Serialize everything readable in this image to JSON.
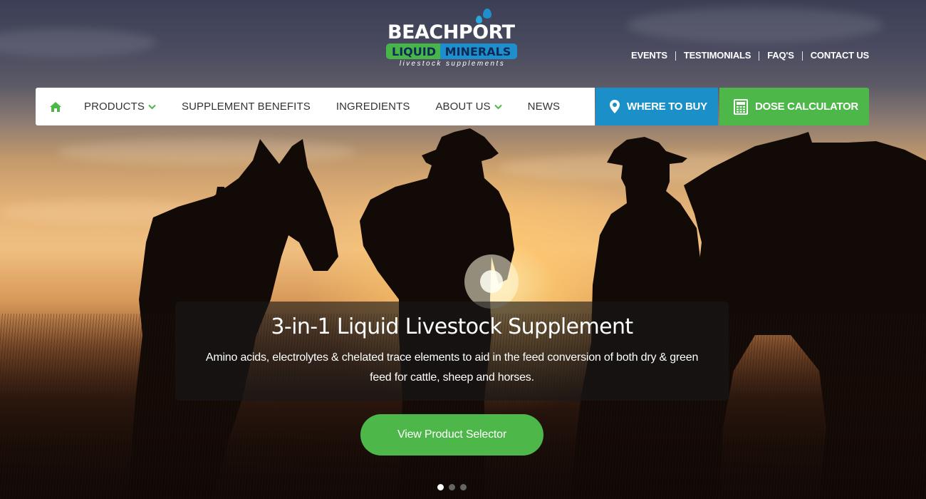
{
  "brand": {
    "name_line1": "BEACHPORT",
    "name_line2a": "LIQUID",
    "name_line2b": "MINERALS",
    "tagline": "livestock supplements",
    "colors": {
      "green": "#4db849",
      "blue": "#1a8fc8",
      "navy": "#0d2a55"
    }
  },
  "top_links": [
    "EVENTS",
    "TESTIMONIALS",
    "FAQ'S",
    "CONTACT US"
  ],
  "nav": {
    "home_icon": "home-icon",
    "items": [
      {
        "label": "PRODUCTS",
        "dropdown": true
      },
      {
        "label": "SUPPLEMENT BENEFITS",
        "dropdown": false
      },
      {
        "label": "INGREDIENTS",
        "dropdown": false
      },
      {
        "label": "ABOUT US",
        "dropdown": true
      },
      {
        "label": "NEWS",
        "dropdown": false
      }
    ],
    "where_to_buy": {
      "label": "WHERE TO BUY",
      "icon": "map-pin-icon",
      "color": "#1a8fc8"
    },
    "dose_calculator": {
      "label": "DOSE CALCULATOR",
      "icon": "calculator-icon",
      "color": "#4db849"
    }
  },
  "hero": {
    "title": "3-in-1 Liquid Livestock Supplement",
    "body": "Amino acids, electrolytes & chelated trace elements to aid in the feed conversion of both dry & green feed for cattle, sheep and horses.",
    "button": "View Product Selector",
    "slides": {
      "count": 3,
      "active": 1
    }
  }
}
